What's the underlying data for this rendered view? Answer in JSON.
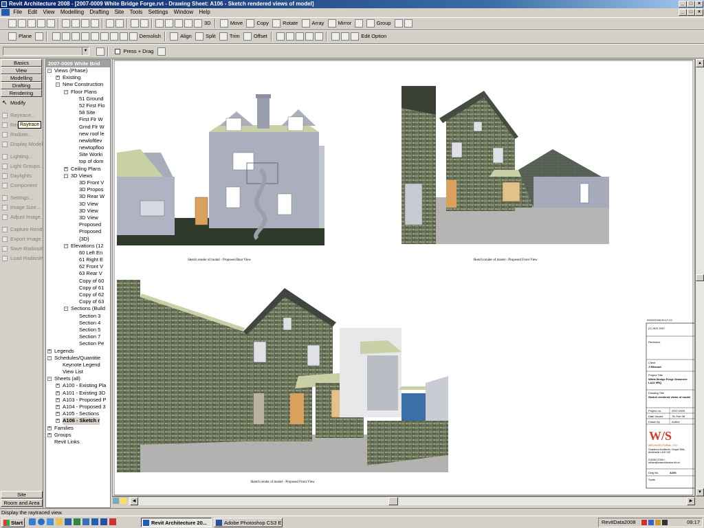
{
  "window": {
    "title": "Revit Architecture 2008 - [2007-0009 White Bridge Forge.rvt - Drawing Sheet: A106 - Sketch rendered views of model]"
  },
  "menu": [
    "File",
    "Edit",
    "View",
    "Modelling",
    "Drafting",
    "Site",
    "Tools",
    "Settings",
    "Window",
    "Help"
  ],
  "toolbar1": {
    "move": "Move",
    "copy": "Copy",
    "rotate": "Rotate",
    "array": "Array",
    "mirror": "Mirror",
    "group": "Group",
    "view3d": "3D"
  },
  "toolbar2": {
    "plane": "Plane",
    "demolish": "Demolish",
    "align": "Align",
    "split": "Split",
    "trim": "Trim",
    "offset": "Offset",
    "edit_option": "Edit Option"
  },
  "toolbar3": {
    "press_drag": "Press + Drag"
  },
  "design_bar": {
    "tabs": [
      "Basics",
      "View",
      "Modelling",
      "Drafting",
      "Rendering"
    ],
    "modify": "Modify",
    "tooltip": "Raytrace",
    "tools": [
      "Raytrace...",
      "Rendering",
      "Radiate...",
      "Display Model",
      "Lighting...",
      "Light Groups...",
      "Daylights",
      "Component",
      "Settings...",
      "Image Size...",
      "Adjust Image...",
      "Capture Rende",
      "Export Image...",
      "Save Radiosity...",
      "Load Radiosity..."
    ],
    "bottom_tabs": [
      "Site",
      "Room and Area"
    ]
  },
  "project_browser": {
    "header": "2007-0009 White Brid",
    "items": [
      {
        "label": "Views (Phase)",
        "level": 0,
        "exp": "-"
      },
      {
        "label": "Existing",
        "level": 1,
        "exp": "+"
      },
      {
        "label": "New Construction",
        "level": 1,
        "exp": "-"
      },
      {
        "label": "Floor Plans",
        "level": 2,
        "exp": "-"
      },
      {
        "label": "51 Ground",
        "level": 3
      },
      {
        "label": "52 First Flo",
        "level": 3
      },
      {
        "label": "58 Site",
        "level": 3
      },
      {
        "label": "First Flr W",
        "level": 3
      },
      {
        "label": "Grnd Flr W",
        "level": 3
      },
      {
        "label": "new roof le",
        "level": 3
      },
      {
        "label": "newloftlev",
        "level": 3
      },
      {
        "label": "newtopfloo",
        "level": 3
      },
      {
        "label": "Site Worki",
        "level": 3
      },
      {
        "label": "top of dom",
        "level": 3
      },
      {
        "label": "Ceiling Plans",
        "level": 2,
        "exp": "+"
      },
      {
        "label": "3D Views",
        "level": 2,
        "exp": "-"
      },
      {
        "label": "3D Front V",
        "level": 3
      },
      {
        "label": "3D Propos",
        "level": 3
      },
      {
        "label": "3D Rear W",
        "level": 3
      },
      {
        "label": "3D View",
        "level": 3
      },
      {
        "label": "3D View",
        "level": 3
      },
      {
        "label": "3D View",
        "level": 3
      },
      {
        "label": "Proposed",
        "level": 3
      },
      {
        "label": "Proposed",
        "level": 3
      },
      {
        "label": "{3D}",
        "level": 3
      },
      {
        "label": "Elevations (12",
        "level": 2,
        "exp": "-"
      },
      {
        "label": "60 Left En",
        "level": 3
      },
      {
        "label": "61 Right E",
        "level": 3
      },
      {
        "label": "62 Front V",
        "level": 3
      },
      {
        "label": "63 Rear V",
        "level": 3
      },
      {
        "label": "Copy of 60",
        "level": 3
      },
      {
        "label": "Copy of 61",
        "level": 3
      },
      {
        "label": "Copy of 62",
        "level": 3
      },
      {
        "label": "Copy of 63",
        "level": 3
      },
      {
        "label": "Sections (Build",
        "level": 2,
        "exp": "-"
      },
      {
        "label": "Section 3",
        "level": 3
      },
      {
        "label": "Section 4",
        "level": 3
      },
      {
        "label": "Section 5",
        "level": 3
      },
      {
        "label": "Section 7",
        "level": 3
      },
      {
        "label": "Section Pe",
        "level": 3
      },
      {
        "label": "Legends",
        "level": 0,
        "exp": "+"
      },
      {
        "label": "Schedules/Quantitie",
        "level": 0,
        "exp": "-"
      },
      {
        "label": "Keynote Legend",
        "level": 1
      },
      {
        "label": "View List",
        "level": 1
      },
      {
        "label": "Sheets (all)",
        "level": 0,
        "exp": "-"
      },
      {
        "label": "A100 - Existing Pla",
        "level": 1,
        "exp": "+"
      },
      {
        "label": "A101 - Existing 3D",
        "level": 1,
        "exp": "+"
      },
      {
        "label": "A103 - Proposed P",
        "level": 1,
        "exp": "+"
      },
      {
        "label": "A104 - Proposed 3",
        "level": 1,
        "exp": "+"
      },
      {
        "label": "A105 - Sections",
        "level": 1,
        "exp": "+"
      },
      {
        "label": "A106 - Sketch r",
        "level": 1,
        "exp": "+",
        "bold": true
      },
      {
        "label": "Families",
        "level": 0,
        "exp": "+"
      },
      {
        "label": "Groups",
        "level": 0,
        "exp": "+"
      },
      {
        "label": "Revit Links",
        "level": 0
      }
    ]
  },
  "sheet": {
    "captions": [
      "Sketch render of model - Proposed Rear View",
      "Sketch render of model - Proposed Front View",
      "Sketch render of model - Proposed Front View"
    ],
    "title_block": {
      "date": "09/02/2008 09:17:22",
      "copyright": "(C) W/S 2007",
      "revisions": "Revisions",
      "client_label": "Client",
      "client": "J Ellwood",
      "project_title_label": "Project Title",
      "project_title": "White Bridge Forge Grasmere LA22 9RQ",
      "drawing_title_label": "Drawing Title",
      "drawing_title": "Sketch rendered views of model",
      "project_no_label": "Project no.",
      "project_no": "2007-0009",
      "date_issued_label": "Date Issued",
      "date_issued": "7th Feb 08",
      "drawn_by_label": "Drawn by",
      "drawn_by": "Author",
      "logo": "W/S",
      "firm": "ARCHITECTURAL LTD",
      "address": "Chartered Architects, Chapel Stile, Ambleside LA22 9JE",
      "contact": "015394 37450 / william@wsarchitecture.ltd.uk",
      "dwg_no_label": "Dwg No.",
      "dwg_no": "A106",
      "scale_label": "Scale"
    }
  },
  "status": "Display the raytraced view.",
  "taskbar": {
    "start": "Start",
    "buttons": [
      "Revit Architecture 20...",
      "Adobe Photoshop CS3 E..."
    ],
    "tray_text": "RevitData2008",
    "clock": "09:17"
  }
}
